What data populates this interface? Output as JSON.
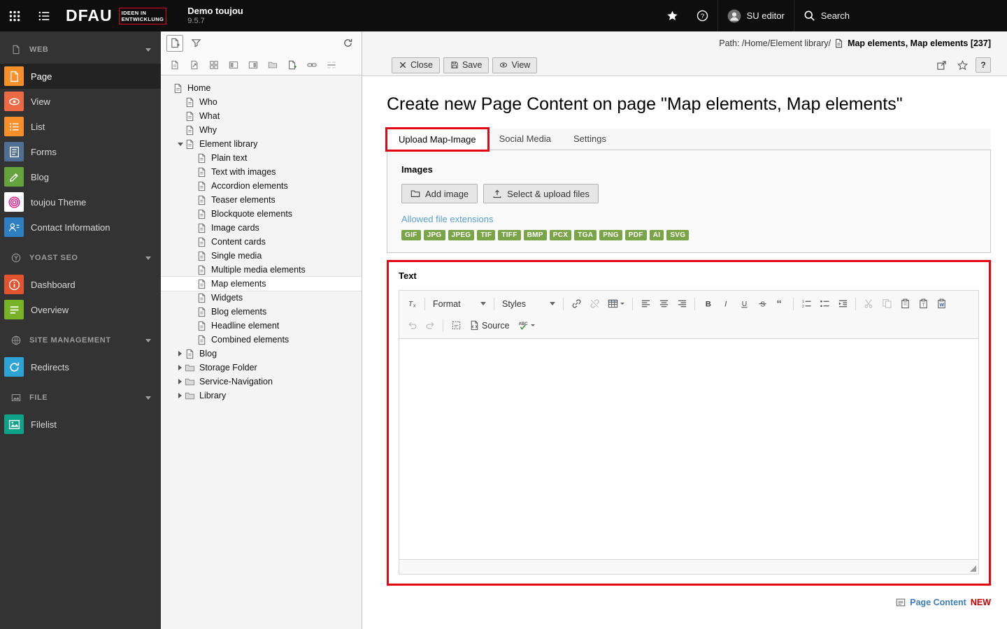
{
  "colors": {
    "annotation": "#e30613",
    "badge": "#79a548",
    "link": "#5a9fd4",
    "new": "#c40000",
    "rectype": "#3d7cb8"
  },
  "topbar": {
    "brand": "DFAU",
    "brand_tag_line1": "IDEEN IN",
    "brand_tag_line2": "ENTWICKLUNG",
    "site_name": "Demo toujou",
    "version": "9.5.7",
    "user_name": "SU editor",
    "search_label": "Search"
  },
  "sidebar": {
    "sections": [
      {
        "label": "WEB",
        "icon": "web",
        "items": [
          {
            "label": "Page",
            "icon": "m-page",
            "bg": "#f7902b",
            "active": true
          },
          {
            "label": "View",
            "icon": "eye",
            "bg": "#ec6a45"
          },
          {
            "label": "List",
            "icon": "listlines",
            "bg": "#f7902b"
          },
          {
            "label": "Forms",
            "icon": "form",
            "bg": "#4f6f94"
          },
          {
            "label": "Blog",
            "icon": "pencil",
            "bg": "#64a33e"
          },
          {
            "label": "toujou Theme",
            "icon": "fingerprint",
            "bg": "#ffffff"
          },
          {
            "label": "Contact Information",
            "icon": "contacts",
            "bg": "#2e7fc1"
          }
        ]
      },
      {
        "label": "YOAST SEO",
        "icon": "yoast",
        "items": [
          {
            "label": "Dashboard",
            "icon": "info",
            "bg": "#e2532f"
          },
          {
            "label": "Overview",
            "icon": "overview",
            "bg": "#77b227"
          }
        ]
      },
      {
        "label": "SITE MANAGEMENT",
        "icon": "globe",
        "items": [
          {
            "label": "Redirects",
            "icon": "redirect",
            "bg": "#2ea3d6"
          }
        ]
      },
      {
        "label": "FILE",
        "icon": "imagehdr",
        "items": [
          {
            "label": "Filelist",
            "icon": "filelist",
            "bg": "#0fa28b"
          }
        ]
      }
    ]
  },
  "pagetree": {
    "toolbar_icons": [
      "t-page",
      "dt-shortcut",
      "dt-grid",
      "dt-left",
      "dt-right",
      "t-folder",
      "docplus",
      "dt-link",
      "dt-divider"
    ],
    "nodes": [
      {
        "label": "Home",
        "depth": 0,
        "icon": "t-page"
      },
      {
        "label": "Who",
        "depth": 1,
        "icon": "t-page"
      },
      {
        "label": "What",
        "depth": 1,
        "icon": "t-page"
      },
      {
        "label": "Why",
        "depth": 1,
        "icon": "t-page"
      },
      {
        "label": "Element library",
        "depth": 1,
        "icon": "t-page",
        "toggle": "expanded"
      },
      {
        "label": "Plain text",
        "depth": 2,
        "icon": "t-page"
      },
      {
        "label": "Text with images",
        "depth": 2,
        "icon": "t-page"
      },
      {
        "label": "Accordion elements",
        "depth": 2,
        "icon": "t-page"
      },
      {
        "label": "Teaser elements",
        "depth": 2,
        "icon": "t-page"
      },
      {
        "label": "Blockquote elements",
        "depth": 2,
        "icon": "t-page"
      },
      {
        "label": "Image cards",
        "depth": 2,
        "icon": "t-page"
      },
      {
        "label": "Content cards",
        "depth": 2,
        "icon": "t-page"
      },
      {
        "label": "Single media",
        "depth": 2,
        "icon": "t-page"
      },
      {
        "label": "Multiple media elements",
        "depth": 2,
        "icon": "t-page"
      },
      {
        "label": "Map elements",
        "depth": 2,
        "icon": "t-page",
        "selected": true
      },
      {
        "label": "Widgets",
        "depth": 2,
        "icon": "t-page"
      },
      {
        "label": "Blog elements",
        "depth": 2,
        "icon": "t-page"
      },
      {
        "label": "Headline element",
        "depth": 2,
        "icon": "t-page"
      },
      {
        "label": "Combined elements",
        "depth": 2,
        "icon": "t-page"
      },
      {
        "label": "Blog",
        "depth": 1,
        "icon": "t-page",
        "toggle": "collapsed"
      },
      {
        "label": "Storage Folder",
        "depth": 1,
        "icon": "t-folder",
        "toggle": "collapsed"
      },
      {
        "label": "Service-Navigation",
        "depth": 1,
        "icon": "t-folder",
        "toggle": "collapsed"
      },
      {
        "label": "Library",
        "depth": 1,
        "icon": "t-folder",
        "toggle": "collapsed"
      }
    ]
  },
  "docheader": {
    "path_label": "Path: /Home/Element library/",
    "record_title": "Map elements, Map elements [237]",
    "close_label": "Close",
    "save_label": "Save",
    "view_label": "View",
    "help_label": "?"
  },
  "content": {
    "title": "Create new Page Content on page \"Map elements, Map elements\"",
    "tabs": [
      {
        "label": "Upload Map-Image",
        "active": true
      },
      {
        "label": "Social Media"
      },
      {
        "label": "Settings"
      }
    ],
    "images_section": {
      "heading": "Images",
      "add_image_label": "Add image",
      "upload_label": "Select & upload files",
      "allowed_link": "Allowed file extensions",
      "extensions": [
        "GIF",
        "JPG",
        "JPEG",
        "TIF",
        "TIFF",
        "BMP",
        "PCX",
        "TGA",
        "PNG",
        "PDF",
        "AI",
        "SVG"
      ]
    },
    "text_section": {
      "heading": "Text",
      "toolbar_row1": [
        {
          "t": "btn",
          "icon": "remove-format"
        },
        {
          "t": "sep"
        },
        {
          "t": "dd",
          "label": "Format"
        },
        {
          "t": "sep"
        },
        {
          "t": "dd",
          "label": "Styles"
        },
        {
          "t": "sep"
        },
        {
          "t": "btn",
          "icon": "link"
        },
        {
          "t": "btn",
          "icon": "unlink",
          "disabled": true
        },
        {
          "t": "btn",
          "icon": "table",
          "caret": true
        },
        {
          "t": "sep"
        },
        {
          "t": "btn",
          "icon": "align-left"
        },
        {
          "t": "btn",
          "icon": "align-center"
        },
        {
          "t": "btn",
          "icon": "align-right"
        },
        {
          "t": "sep"
        },
        {
          "t": "btn",
          "icon": "bold"
        },
        {
          "t": "btn",
          "icon": "italic"
        },
        {
          "t": "btn",
          "icon": "underline"
        },
        {
          "t": "btn",
          "icon": "strike"
        },
        {
          "t": "btn",
          "icon": "blockquote"
        },
        {
          "t": "sep"
        },
        {
          "t": "btn",
          "icon": "ordered-list"
        },
        {
          "t": "btn",
          "icon": "bullet-list"
        },
        {
          "t": "btn",
          "icon": "indent"
        },
        {
          "t": "sep"
        },
        {
          "t": "btn",
          "icon": "cut",
          "disabled": true
        },
        {
          "t": "btn",
          "icon": "copy",
          "disabled": true
        },
        {
          "t": "btn",
          "icon": "paste"
        },
        {
          "t": "btn",
          "icon": "paste-text"
        },
        {
          "t": "btn",
          "icon": "paste-word"
        }
      ],
      "toolbar_row2": [
        {
          "t": "btn",
          "icon": "undo",
          "disabled": true
        },
        {
          "t": "btn",
          "icon": "redo",
          "disabled": true
        },
        {
          "t": "sep"
        },
        {
          "t": "btn",
          "icon": "select-all"
        },
        {
          "t": "btn",
          "icon": "source",
          "label": "Source"
        },
        {
          "t": "btn",
          "icon": "spellcheck",
          "caret": true
        }
      ]
    },
    "footer": {
      "record_type": "Page Content",
      "state": "NEW"
    }
  }
}
